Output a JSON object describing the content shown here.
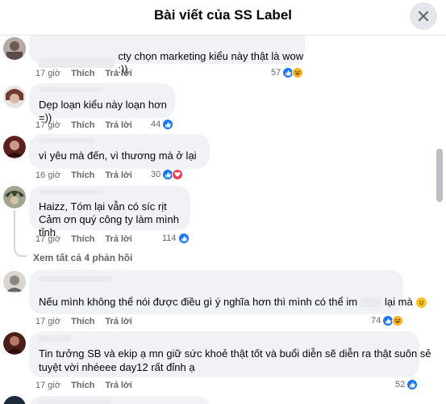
{
  "header": {
    "title": "Bài viết của SS Label"
  },
  "comments": [
    {
      "text": "cty chọn marketing kiểu này thật là wow :))",
      "time": "17 giờ",
      "like": "Thích",
      "reply": "Trả lời",
      "count": "57"
    },
    {
      "text": "Dẹp loạn kiểu này loạn hơn =))",
      "time": "17 giờ",
      "like": "Thích",
      "reply": "Trả lời",
      "count": "44"
    },
    {
      "text": "vì yêu mà đến, vì thương mà ở lại",
      "time": "16 giờ",
      "like": "Thích",
      "reply": "Trả lời",
      "count": "30"
    },
    {
      "line1": "Haizz, Tóm lại vẫn có síc rịt",
      "line2": "Cảm ơn quý công ty làm mình tỉnh",
      "time": "17 giờ",
      "like": "Thích",
      "reply": "Trả lời",
      "count": "114"
    },
    {
      "text_a": "Nếu mình không thể nói được điều gì ý nghĩa hơn thì mình có thể im",
      "text_b": "lại mà",
      "time": "17 giờ",
      "like": "Thích",
      "reply": "Trả lời",
      "count": "74"
    },
    {
      "line1": "Tin tưởng SB và ekip ạ mn giữ sức khoẻ thật tốt và buổi diễn sẽ diễn ra thật suôn sẻ",
      "line2": "tuyệt vời nhéeee day12 rất đỉnh ạ",
      "time": "17 giờ",
      "like": "Thích",
      "reply": "Trả lời",
      "count": "52"
    }
  ],
  "more_replies": "Xem tất cả 4 phản hồi",
  "icons": {
    "like": "like-icon",
    "heart": "heart-icon",
    "haha": "haha-icon",
    "close": "close-icon"
  },
  "colors": {
    "like": "#1877f2",
    "heart": "#f33e58",
    "haha": "#f7b125"
  }
}
